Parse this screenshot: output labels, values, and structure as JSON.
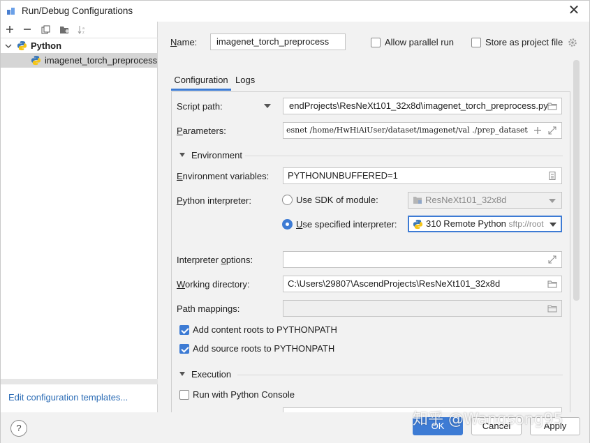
{
  "window": {
    "title": "Run/Debug Configurations"
  },
  "toolbar": {
    "icons": [
      "add-icon",
      "remove-icon",
      "copy-icon",
      "folder-add-icon",
      "sort-icon"
    ]
  },
  "tree": {
    "group": "Python",
    "items": [
      "imagenet_torch_preprocess"
    ]
  },
  "edit_templates": "Edit configuration templates...",
  "form": {
    "name_label": "Name:",
    "name_value": "imagenet_torch_preprocess",
    "allow_parallel": "Allow parallel run",
    "store_project": "Store as project file",
    "tabs": [
      "Configuration",
      "Logs"
    ],
    "script_path_label": "Script path:",
    "script_path_value": "endProjects\\ResNeXt101_32x8d\\imagenet_torch_preprocess.py",
    "parameters_label": "Parameters:",
    "parameters_value": "esnet /home/HwHiAiUser/dataset/imagenet/val ./prep_dataset",
    "environment_section": "Environment",
    "env_vars_label": "Environment variables:",
    "env_vars_value": "PYTHONUNBUFFERED=1",
    "interpreter_label": "Python interpreter:",
    "use_sdk_label": "Use SDK of module:",
    "sdk_module_value": "ResNeXt101_32x8d",
    "use_specified_label": "Use specified interpreter:",
    "interpreter_value": "310 Remote Python",
    "interpreter_suffix": "sftp://root",
    "interp_options_label": "Interpreter options:",
    "interp_options_value": "",
    "working_dir_label": "Working directory:",
    "working_dir_value": "C:\\Users\\29807\\AscendProjects\\ResNeXt101_32x8d",
    "path_mappings_label": "Path mappings:",
    "add_content_roots": "Add content roots to PYTHONPATH",
    "add_source_roots": "Add source roots to PYTHONPATH",
    "execution_section": "Execution",
    "run_with_console": "Run with Python Console"
  },
  "buttons": {
    "help": "?",
    "ok": "OK",
    "cancel": "Cancel",
    "apply": "Apply"
  },
  "watermark": "知乎 @Wangsong95",
  "colors": {
    "accent": "#3d7bd4",
    "link": "#2a6bb5"
  }
}
